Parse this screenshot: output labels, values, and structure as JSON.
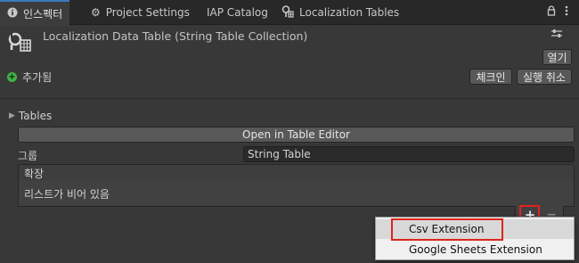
{
  "tabs": [
    {
      "label": "인스펙터",
      "icon": "info-icon"
    },
    {
      "label": "Project Settings",
      "icon": "gear-icon"
    },
    {
      "label": "IAP Catalog"
    },
    {
      "label": "Localization Tables",
      "icon": "localization-icon"
    }
  ],
  "header": {
    "title": "Localization Data Table (String Table Collection)",
    "open_label": "열기"
  },
  "status": {
    "added_label": "추가됨",
    "checkin_label": "체크인",
    "undo_label": "실행 취소"
  },
  "tables": {
    "foldout_label": "Tables",
    "open_editor_label": "Open in Table Editor",
    "group_label": "그룹",
    "group_value": "String Table"
  },
  "extensions": {
    "header_label": "확장",
    "empty_label": "리스트가 비어 있음",
    "add_label": "+",
    "remove_label": "−"
  },
  "dropdown": {
    "items": [
      "Csv Extension",
      "Google Sheets Extension"
    ]
  },
  "colors": {
    "highlight": "#e0241c",
    "added": "#41b345",
    "tab_accent": "#3a79bb"
  }
}
